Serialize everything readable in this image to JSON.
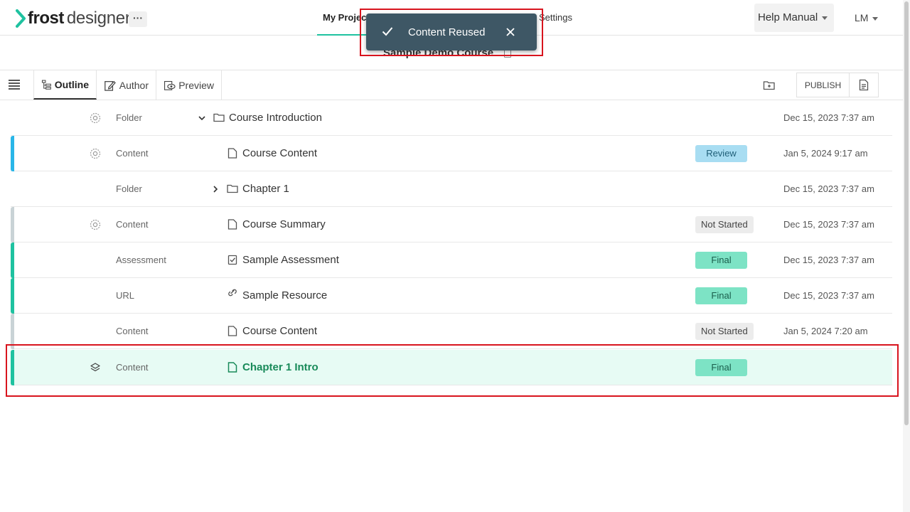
{
  "header": {
    "logo_bold": "frost",
    "logo_light": "designer",
    "more_label": "···",
    "nav": [
      "My Projects",
      "Settings"
    ],
    "help_label": "Help Manual",
    "user_label": "LM"
  },
  "course": {
    "title": "Sample Demo Course"
  },
  "toolbar": {
    "tabs": [
      "Outline",
      "Author",
      "Preview"
    ],
    "publish_label": "PUBLISH"
  },
  "toast": {
    "message": "Content Reused"
  },
  "rows": [
    {
      "type": "Folder",
      "name": "Course Introduction",
      "badge": "",
      "date": "Dec 15, 2023 7:37 am"
    },
    {
      "type": "Content",
      "name": "Course Content",
      "badge": "Review",
      "date": "Jan 5, 2024 9:17 am"
    },
    {
      "type": "Folder",
      "name": "Chapter 1",
      "badge": "",
      "date": "Dec 15, 2023 7:37 am"
    },
    {
      "type": "Content",
      "name": "Course Summary",
      "badge": "Not Started",
      "date": "Dec 15, 2023 7:37 am"
    },
    {
      "type": "Assessment",
      "name": "Sample Assessment",
      "badge": "Final",
      "date": "Dec 15, 2023 7:37 am"
    },
    {
      "type": "URL",
      "name": "Sample Resource",
      "badge": "Final",
      "date": "Dec 15, 2023 7:37 am"
    },
    {
      "type": "Content",
      "name": "Course Content",
      "badge": "Not Started",
      "date": "Jan 5, 2024 7:20 am"
    },
    {
      "type": "Content",
      "name": "Chapter 1 Intro",
      "badge": "Final",
      "date": ""
    }
  ],
  "colors": {
    "accent": "#1fc2a0",
    "review_bar": "#29b6e8",
    "final_bar": "#1fc2a0",
    "notstarted_bar": "#c9d3d6",
    "toast_bg": "#3e5765",
    "annotation": "#d8141e"
  }
}
